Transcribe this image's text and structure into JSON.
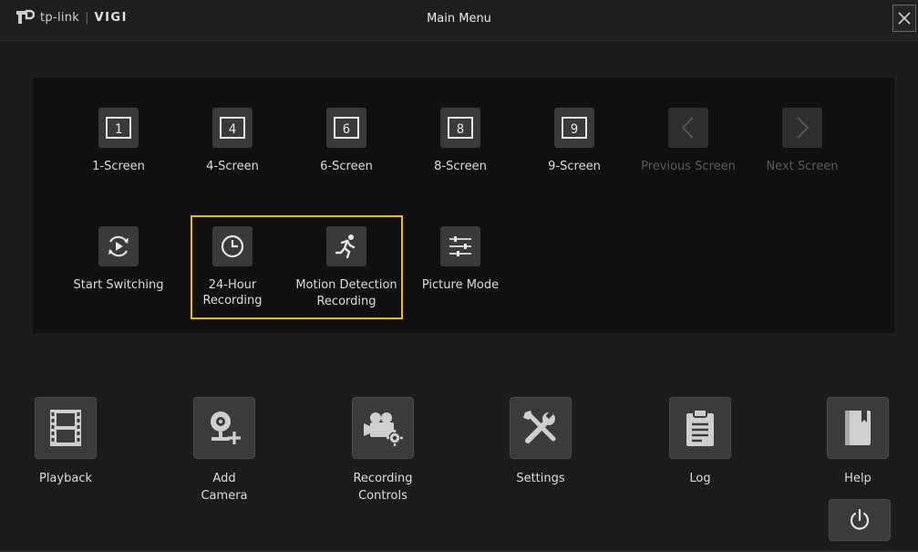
{
  "header": {
    "brand": "tp-link",
    "separator": "|",
    "product": "VIGI",
    "title": "Main Menu",
    "close_icon": "close-icon"
  },
  "screen_modes": [
    {
      "label": "1-Screen",
      "icon": "1"
    },
    {
      "label": "4-Screen",
      "icon": "4"
    },
    {
      "label": "6-Screen",
      "icon": "6"
    },
    {
      "label": "8-Screen",
      "icon": "8"
    },
    {
      "label": "9-Screen",
      "icon": "9"
    },
    {
      "label": "Previous Screen",
      "icon": "chevron-left-icon",
      "disabled": true
    },
    {
      "label": "Next Screen",
      "icon": "chevron-right-icon",
      "disabled": true
    }
  ],
  "functions": [
    {
      "label": "Start Switching",
      "icon": "switch-cycle-icon"
    },
    {
      "label_line1": "24-Hour",
      "label_line2": "Recording",
      "icon": "clock-icon"
    },
    {
      "label_line1": "Motion Detection",
      "label_line2": "Recording",
      "icon": "running-person-icon"
    },
    {
      "label": "Picture Mode",
      "icon": "sliders-icon"
    }
  ],
  "main_menu": [
    {
      "label": "Playback",
      "icon": "film-icon"
    },
    {
      "label_line1": "Add",
      "label_line2": "Camera",
      "icon": "add-camera-icon"
    },
    {
      "label_line1": "Recording",
      "label_line2": "Controls",
      "icon": "recording-camera-icon"
    },
    {
      "label": "Settings",
      "icon": "tools-icon"
    },
    {
      "label": "Log",
      "icon": "clipboard-icon"
    },
    {
      "label": "Help",
      "icon": "book-icon"
    }
  ],
  "power": {
    "icon": "power-icon"
  },
  "colors": {
    "highlight": "#f2b90f",
    "background": "#1c1c1c",
    "panel": "#101010"
  }
}
